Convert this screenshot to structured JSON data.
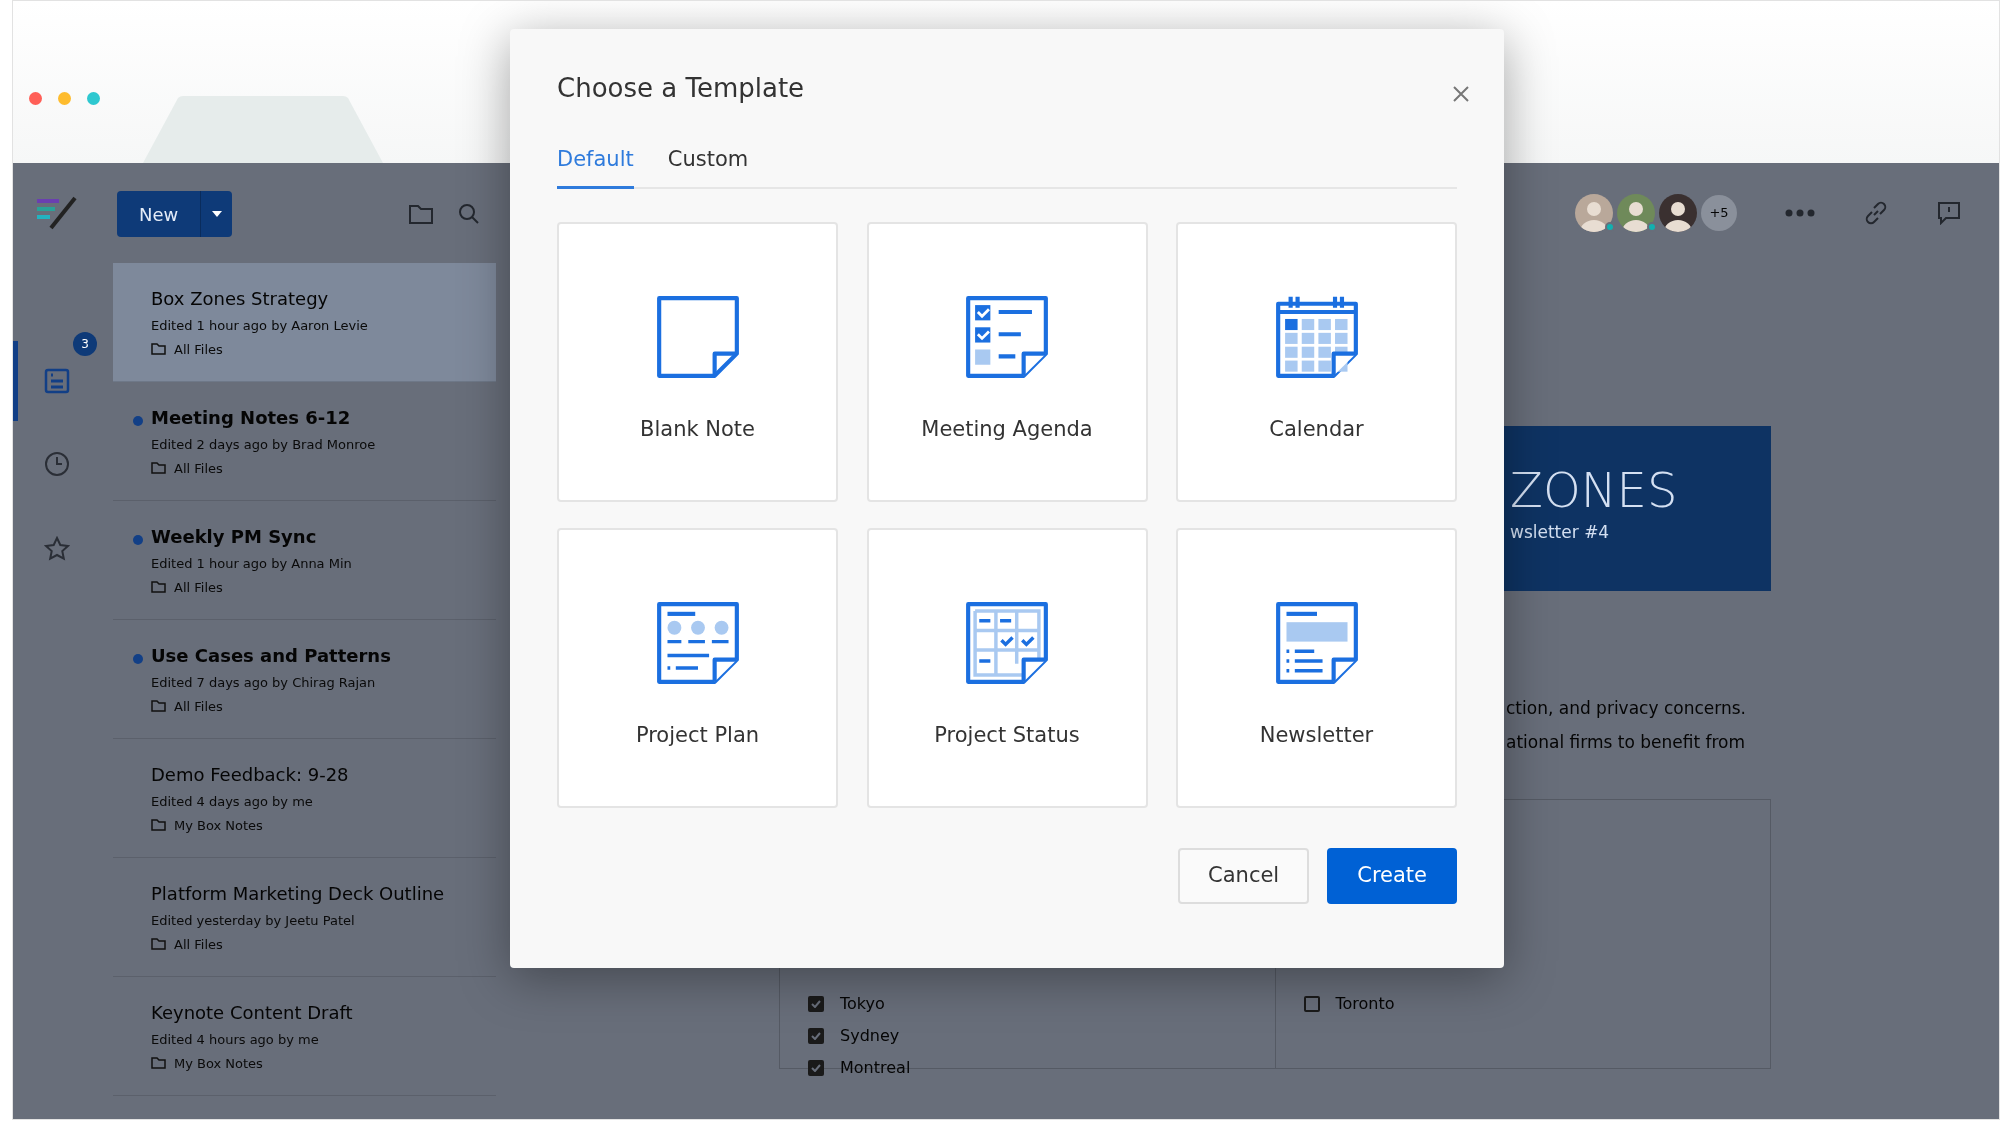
{
  "browser": {
    "window_controls": [
      {
        "color": "#ff5f57"
      },
      {
        "color": "#febc2e"
      },
      {
        "color": "#2ec8d0"
      }
    ]
  },
  "app": {
    "new_button": {
      "label": "New"
    },
    "rail": [
      {
        "kind": "notes",
        "selected": true,
        "badge": "3"
      },
      {
        "kind": "recent",
        "selected": false
      },
      {
        "kind": "starred",
        "selected": false
      }
    ],
    "notes": [
      {
        "title": "Box Zones Strategy",
        "meta": "Edited 1 hour ago by Aaron Levie",
        "folder": "All Files",
        "unread": false,
        "selected": true
      },
      {
        "title": "Meeting Notes 6-12",
        "meta": "Edited 2 days ago by Brad Monroe",
        "folder": "All Files",
        "unread": true,
        "selected": false
      },
      {
        "title": "Weekly PM Sync",
        "meta": "Edited 1 hour ago by Anna Min",
        "folder": "All Files",
        "unread": true,
        "selected": false
      },
      {
        "title": "Use Cases and Patterns",
        "meta": "Edited 7 days ago by Chirag Rajan",
        "folder": "All Files",
        "unread": true,
        "selected": false
      },
      {
        "title": "Demo Feedback: 9-28",
        "meta": "Edited 4 days ago by me",
        "folder": "My Box Notes",
        "unread": false,
        "selected": false
      },
      {
        "title": "Platform Marketing Deck Outline",
        "meta": "Edited yesterday by Jeetu Patel",
        "folder": "All Files",
        "unread": false,
        "selected": false
      },
      {
        "title": "Keynote Content Draft",
        "meta": "Edited 4 hours ago by me",
        "folder": "My Box Notes",
        "unread": false,
        "selected": false
      }
    ],
    "collaborators": [
      {
        "online": true
      },
      {
        "online": true
      },
      {
        "online": false
      }
    ],
    "more_collaborators": "+5",
    "document": {
      "banner_title": "ZONES",
      "banner_subtitle": "wsletter #4",
      "paragraph_lines": [
        "ction, and privacy concerns.",
        "ational firms to benefit from"
      ],
      "checklist_columns": [
        [
          {
            "label": "Tokyo",
            "checked": true
          },
          {
            "label": "Sydney",
            "checked": true
          },
          {
            "label": "Montreal",
            "checked": true
          }
        ],
        [
          {
            "label": "Toronto",
            "checked": false
          }
        ]
      ]
    }
  },
  "modal": {
    "title": "Choose a Template",
    "tabs": [
      {
        "label": "Default",
        "selected": true
      },
      {
        "label": "Custom",
        "selected": false
      }
    ],
    "templates": [
      {
        "kind": "blank",
        "label": "Blank Note"
      },
      {
        "kind": "agenda",
        "label": "Meeting Agenda"
      },
      {
        "kind": "calendar",
        "label": "Calendar"
      },
      {
        "kind": "plan",
        "label": "Project Plan"
      },
      {
        "kind": "status",
        "label": "Project Status"
      },
      {
        "kind": "newsletter",
        "label": "Newsletter"
      }
    ],
    "buttons": [
      {
        "kind": "secondary",
        "label": "Cancel"
      },
      {
        "kind": "primary",
        "label": "Create"
      }
    ]
  }
}
